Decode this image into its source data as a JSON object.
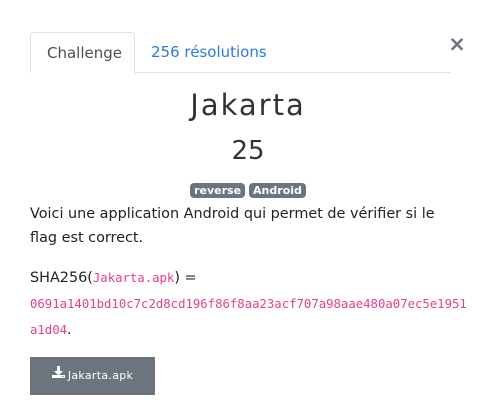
{
  "tabs": {
    "challenge": "Challenge",
    "solves": "256 résolutions"
  },
  "close_label": "×",
  "challenge": {
    "name": "Jakarta",
    "value": "25",
    "tags": [
      "reverse",
      "Android"
    ],
    "description": "Voici une application Android qui permet de vérifier si le flag est correct."
  },
  "hash": {
    "prefix": "SHA256(",
    "filename": "Jakarta.apk",
    "suffix": ") =",
    "value": "0691a1401bd10c7c2d8cd196f86f8aa23acf707a98aae480a07ec5e1951a1d04",
    "end": "."
  },
  "download": {
    "label": "Jakarta.apk",
    "icon": "download-icon"
  }
}
